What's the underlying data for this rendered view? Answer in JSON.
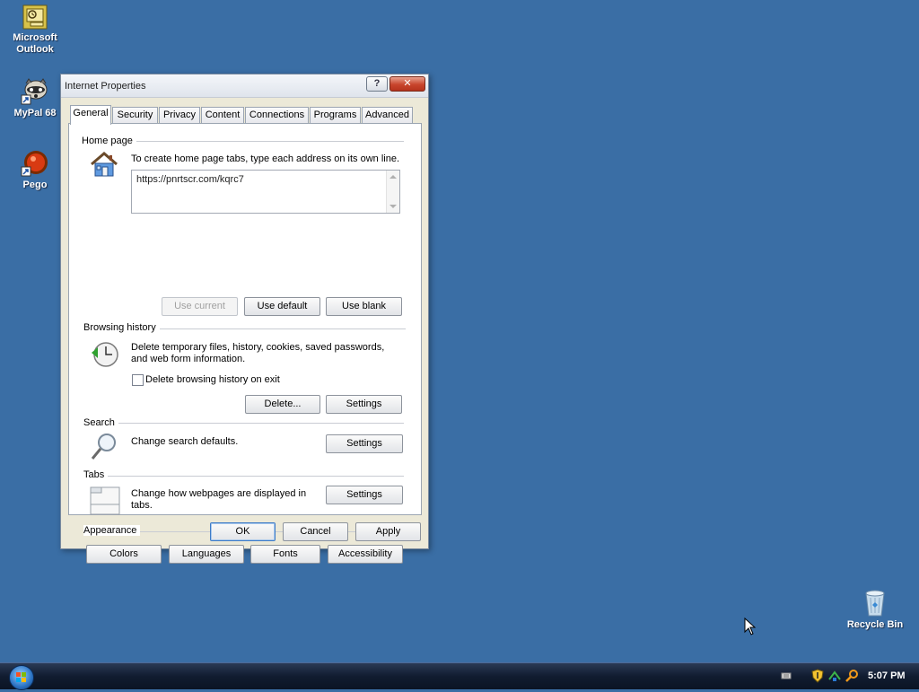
{
  "desktop": {
    "icons": [
      {
        "label_line1": "Microsoft",
        "label_line2": "Outlook",
        "icon": "outlook-icon"
      },
      {
        "label": "MyPal 68",
        "icon": "mypal-icon"
      },
      {
        "label": "Pego",
        "icon": "pego-icon"
      },
      {
        "label": "Recycle Bin",
        "icon": "recycle-bin-icon"
      }
    ],
    "background_color": "#3a6ea5"
  },
  "dialog": {
    "title": "Internet Properties",
    "help_glyph": "?",
    "close_glyph": "✕",
    "tabs": [
      {
        "label": "General",
        "active": true
      },
      {
        "label": "Security"
      },
      {
        "label": "Privacy"
      },
      {
        "label": "Content"
      },
      {
        "label": "Connections"
      },
      {
        "label": "Programs"
      },
      {
        "label": "Advanced"
      }
    ],
    "home_page": {
      "heading": "Home page",
      "description": "To create home page tabs, type each address on its own line.",
      "value": "https://pnrtscr.com/kqrc7",
      "buttons": {
        "use_current": "Use current",
        "use_default": "Use default",
        "use_blank": "Use blank"
      }
    },
    "browsing_history": {
      "heading": "Browsing history",
      "description_line1": "Delete temporary files, history, cookies, saved passwords,",
      "description_line2": "and web form information.",
      "checkbox_label": "Delete browsing history on exit",
      "checkbox_checked": false,
      "buttons": {
        "delete": "Delete...",
        "settings": "Settings"
      }
    },
    "search": {
      "heading": "Search",
      "description": "Change search defaults.",
      "settings": "Settings"
    },
    "tabs_section": {
      "heading": "Tabs",
      "description_line1": "Change how webpages are displayed in",
      "description_line2": "tabs.",
      "settings": "Settings"
    },
    "appearance": {
      "heading": "Appearance",
      "buttons": {
        "colors": "Colors",
        "languages": "Languages",
        "fonts": "Fonts",
        "accessibility": "Accessibility"
      }
    },
    "footer": {
      "ok": "OK",
      "cancel": "Cancel",
      "apply": "Apply"
    }
  },
  "taskbar": {
    "clock": "5:07 PM",
    "tray_icons": [
      "keyboard-icon",
      "shield-icon",
      "network-icon",
      "search-icon"
    ]
  }
}
